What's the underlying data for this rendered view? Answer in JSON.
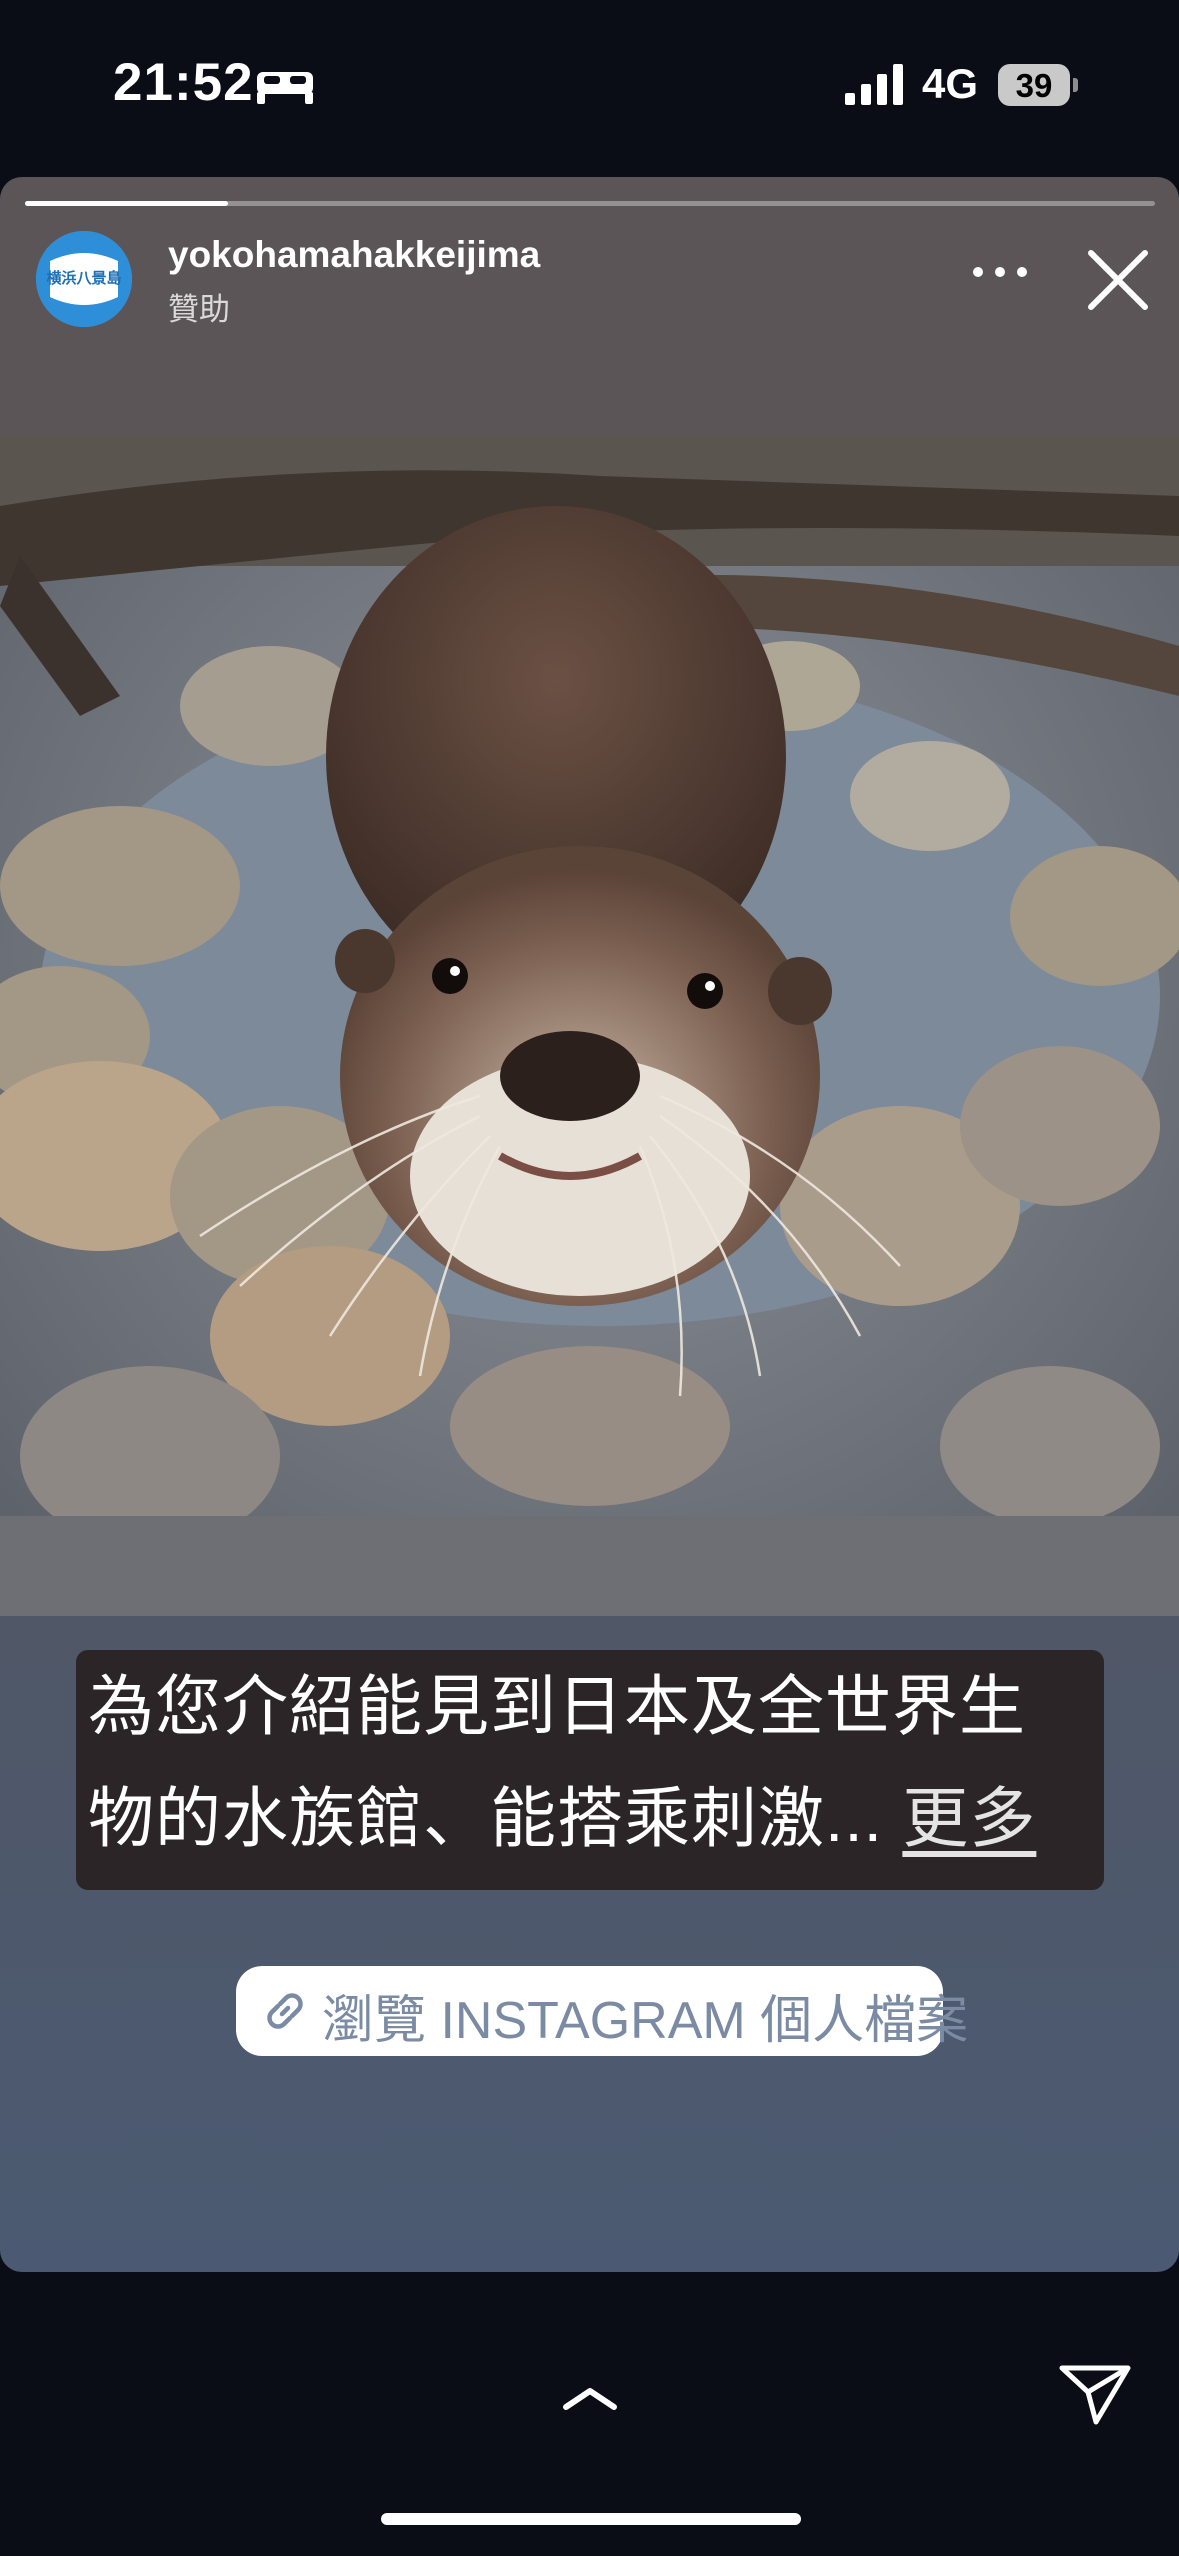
{
  "status_bar": {
    "time": "21:52",
    "network": "4G",
    "battery": "39"
  },
  "story": {
    "progress": 0.18,
    "account_name": "yokohamahakkeijima",
    "sponsored_label": "贊助",
    "avatar_text": "横浜八景島",
    "caption_line1": "為您介紹能見到日本及全世界生",
    "caption_line2": "物的水族館、能搭乘刺激...",
    "caption_more": "更多",
    "cta_label": "瀏覽 INSTAGRAM 個人檔案"
  },
  "icons": {
    "bed": "bed-icon",
    "signal": "cellular-signal-icon",
    "more": "more-options-icon",
    "close": "close-icon",
    "link": "link-icon",
    "chevron": "chevron-up-icon",
    "send": "send-icon"
  }
}
